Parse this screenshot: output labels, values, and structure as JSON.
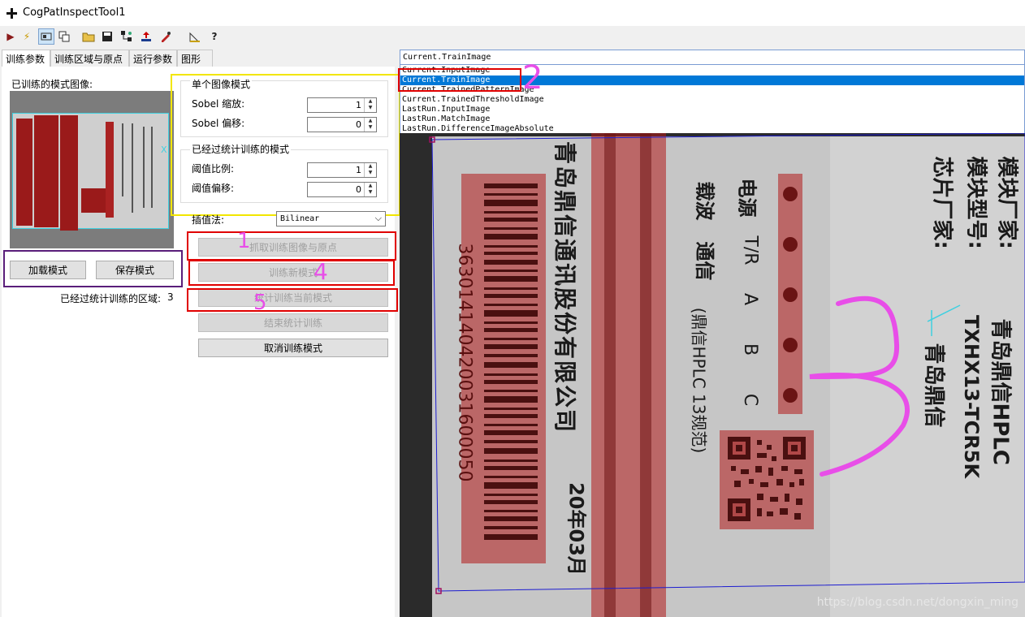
{
  "window": {
    "title": "CogPatInspectTool1"
  },
  "toolbar": {
    "buttons": [
      {
        "name": "run-icon",
        "glyph": "▶"
      },
      {
        "name": "electric-icon",
        "glyph": "⚡"
      },
      {
        "name": "display-icon",
        "glyph": "▭"
      },
      {
        "name": "copy-icon",
        "glyph": "⧉"
      },
      {
        "name": "open-folder-icon",
        "glyph": "📂"
      },
      {
        "name": "save-icon",
        "glyph": "💾"
      },
      {
        "name": "network-icon",
        "glyph": "⊞"
      },
      {
        "name": "upload-icon",
        "glyph": "⇪"
      },
      {
        "name": "settings-tool-icon",
        "glyph": "✎"
      },
      {
        "name": "measure-icon",
        "glyph": "📐"
      },
      {
        "name": "help-icon",
        "glyph": "?"
      }
    ]
  },
  "tabs": [
    {
      "label": "训练参数",
      "active": true
    },
    {
      "label": "训练区域与原点",
      "active": false
    },
    {
      "label": "运行参数",
      "active": false
    },
    {
      "label": "图形",
      "active": false
    }
  ],
  "left": {
    "trained_pattern_label": "已训练的模式图像:",
    "load_pattern": "加载模式",
    "save_pattern": "保存模式",
    "single_group_title": "单个图像模式",
    "sobel_scale_label": "Sobel 缩放:",
    "sobel_scale_value": "1",
    "sobel_offset_label": "Sobel 偏移:",
    "sobel_offset_value": "0",
    "stat_group_title": "已经过统计训练的模式",
    "threshold_scale_label": "阈值比例:",
    "threshold_scale_value": "1",
    "threshold_offset_label": "阈值偏移:",
    "threshold_offset_value": "0",
    "interp_label": "插值法:",
    "interp_value": "Bilinear",
    "btn_grab": "抓取训练图像与原点",
    "btn_train_new": "训练新模式",
    "btn_stat_train": "统计训练当前模式",
    "btn_end_stat": "结束统计训练",
    "btn_cancel": "取消训练模式",
    "stat_count_label": "已经过统计训练的区域:",
    "stat_count_value": "3"
  },
  "right": {
    "combo_value": "Current.TrainImage",
    "list": [
      "Current.InputImage",
      "Current.TrainImage",
      "Current.TrainedPatternImage",
      "Current.TrainedThresholdImage",
      "LastRun.InputImage",
      "LastRun.MatchImage",
      "LastRun.DifferenceImageAbsolute"
    ],
    "selected_index": 1
  },
  "annotations": [
    "1",
    "2",
    "3",
    "4",
    "5"
  ],
  "label_image": {
    "company": "青岛鼎信通讯股份有限公司",
    "barcode_digits": "363014140420031600050",
    "date": "20年03月",
    "power": "电源",
    "tr": "T/R",
    "a": "A",
    "b": "B",
    "c": "C",
    "carrier": "载波",
    "comm": "通信",
    "std": "(鼎信HPLC 13规范)",
    "maker_label": "模块厂家:",
    "maker_value": "青岛鼎信HPLC",
    "model_label": "模块型号:",
    "model_value": "TXHX13-TCR5K",
    "chip_label": "芯片厂家:",
    "chip_value": "青岛鼎信"
  },
  "watermark": "https://blog.csdn.net/dongxin_ming",
  "thumb_marker": "X",
  "colors": {
    "mask_red": "#b21a1a",
    "annot_red": "#e00000",
    "annot_yellow": "#f2e600",
    "annot_purple": "#5a1e7a",
    "annot_magenta": "#e84ee8",
    "selection_blue": "#0078d7"
  }
}
